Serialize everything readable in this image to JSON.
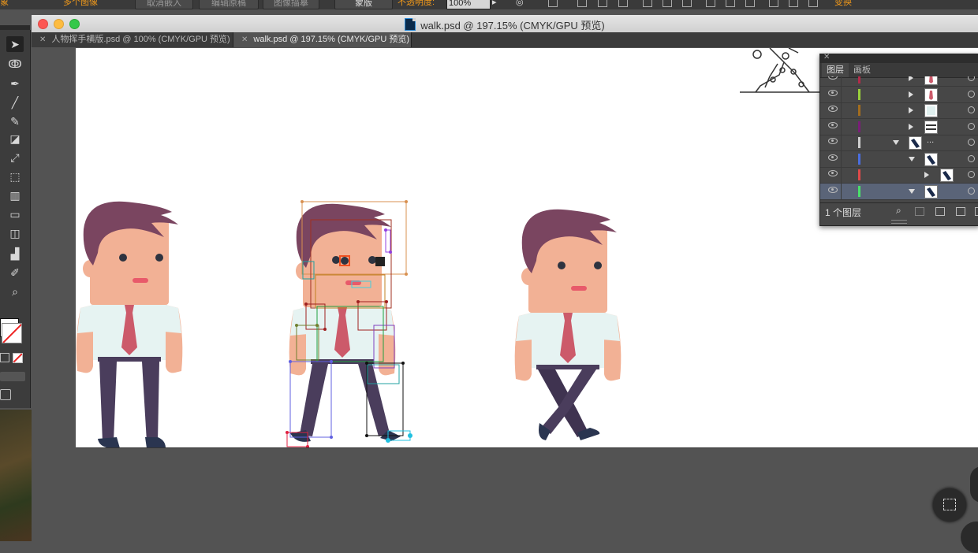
{
  "control_bar": {
    "left_label": "多个图像",
    "btn_unembed": "取消嵌入",
    "btn_edit_original": "编辑原稿",
    "btn_image_trace": "图像描摹",
    "btn_mask": "蒙版",
    "opacity_label": "不透明度:",
    "opacity_value": "100%",
    "transform_label": "变换",
    "partial_left": "象"
  },
  "window": {
    "title": "walk.psd @ 197.15% (CMYK/GPU 预览)"
  },
  "tabs": [
    {
      "label": "人物挥手横版.psd @ 100% (CMYK/GPU 预览)"
    },
    {
      "label": "walk.psd @ 197.15% (CMYK/GPU 预览)"
    }
  ],
  "tools": [
    "selection-tool",
    "lasso-tool",
    "pen-tool",
    "line-tool",
    "paintbrush-tool",
    "eraser-tool",
    "scale-tool",
    "free-transform-tool",
    "symbol-sprayer-tool",
    "gradient-tool",
    "shape-builder-tool",
    "column-graph-tool",
    "eyedropper-tool",
    "zoom-tool"
  ],
  "layers_panel": {
    "tab_layers": "图层",
    "tab_artboards": "画板",
    "footer_count": "1 个图层",
    "rows": [
      {
        "color": "#b32b4a",
        "indent": "child",
        "thumb": "tie",
        "expanded": false
      },
      {
        "color": "#9ad13b",
        "indent": "child",
        "thumb": "tie",
        "expanded": false
      },
      {
        "color": "#a46d1e",
        "indent": "child",
        "thumb": "shirt",
        "expanded": false
      },
      {
        "color": "#7a1e78",
        "indent": "child",
        "thumb": "belt",
        "expanded": false
      },
      {
        "color": "#cfcfcf",
        "indent": "group",
        "thumb": "leg",
        "expanded": true,
        "dots": "..."
      },
      {
        "color": "#4a6ee0",
        "indent": "child",
        "thumb": "leg",
        "expanded": true
      },
      {
        "color": "#e04a4a",
        "indent": "sub",
        "thumb": "leg",
        "expanded": false
      },
      {
        "color": "#4ae06a",
        "indent": "child",
        "thumb": "leg",
        "expanded": true,
        "selected": true
      }
    ]
  },
  "colors": {
    "hair": "#7a4560",
    "skin": "#f2b195",
    "shirt": "#e6f3f2",
    "tie": "#cc5a6a",
    "pants": "#4a3d5c",
    "shoes": "#2a3550",
    "mouth": "#e85a6a",
    "eyes": "#2e3340"
  }
}
